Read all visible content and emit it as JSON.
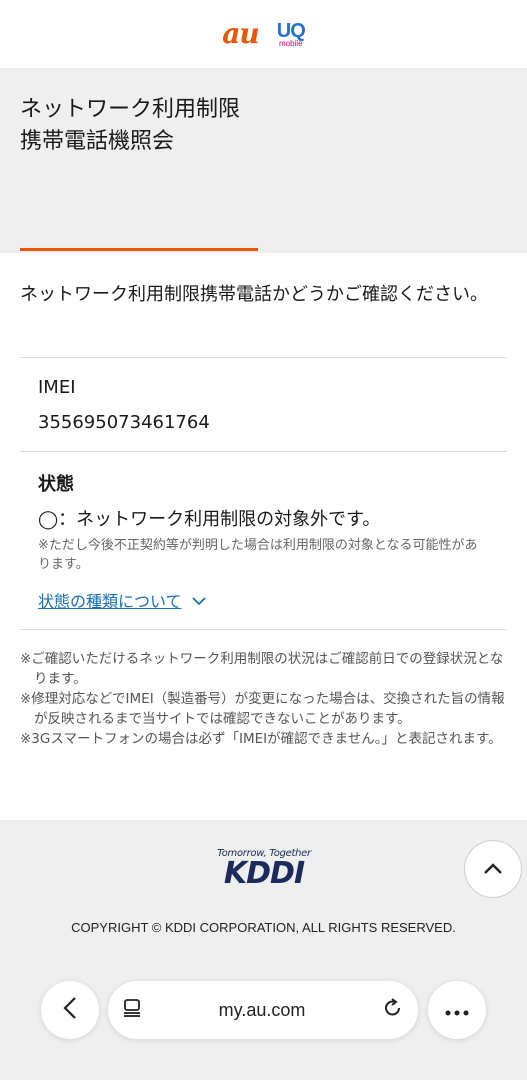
{
  "header": {
    "logo_au": "au",
    "logo_uq": "UQ",
    "logo_uq_sub": "mobile"
  },
  "title": {
    "line1": "ネットワーク利用制限",
    "line2": "携帯電話機照会",
    "accent_color": "#eb5505"
  },
  "question": "ネットワーク利用制限携帯電話かどうかご確認ください。",
  "imei": {
    "label": "IMEI",
    "value": "355695073461764"
  },
  "status": {
    "label": "状態",
    "text": "◯：ネットワーク利用制限の対象外です。",
    "note": "※ただし今後不正契約等が判明した場合は利用制限の対象となる可能性があります。",
    "link": "状態の種類について"
  },
  "footnotes": [
    "※ご確認いただけるネットワーク利用制限の状況はご確認前日での登録状況となります。",
    "※修理対応などでIMEI（製造番号）が変更になった場合は、交換された旨の情報が反映されるまで当サイトでは確認できないことがあります。",
    "※3Gスマートフォンの場合は必ず「IMEIが確認できません。」と表記されます。"
  ],
  "back_label": "戻る",
  "footer": {
    "kddi_tagline": "Tomorrow, Together",
    "kddi_logo": "KDDI",
    "copyright": "COPYRIGHT © KDDI CORPORATION, ALL RIGHTS RESERVED."
  },
  "browser": {
    "url": "my.au.com"
  },
  "icons": [
    "back-chevron-icon",
    "tabs-icon",
    "reload-icon",
    "more-icon",
    "scroll-top-icon",
    "chevron-down-icon",
    "chevron-left-icon"
  ],
  "colors": {
    "link": "#1a6fb5",
    "background_gray": "#efefef",
    "kddi_navy": "#1b2b5b"
  }
}
